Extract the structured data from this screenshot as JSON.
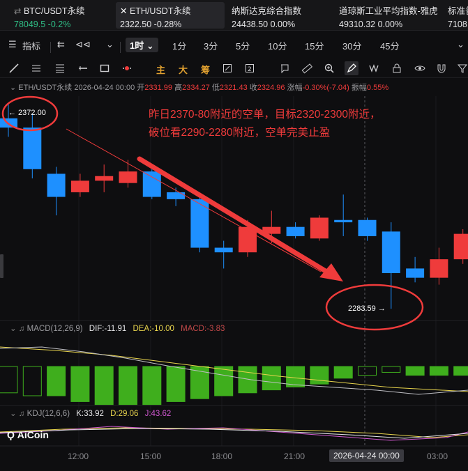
{
  "tickers": [
    {
      "name": "BTC/USDT永续",
      "price": "78049.5",
      "change": "-0.2%"
    },
    {
      "name": "ETH/USDT永续",
      "price": "2322.50",
      "change": "-0.28%"
    },
    {
      "name": "纳斯达克综合指数",
      "price": "24438.50",
      "change": "0.00%"
    },
    {
      "name": "道琼斯工业平均指数-雅虎",
      "price": "49310.32",
      "change": "0.00%"
    },
    {
      "name": "标准普",
      "price": "7108",
      "change": ""
    }
  ],
  "timeframe": {
    "indicator_label": "指标",
    "selected": "1时",
    "options": [
      "1分",
      "3分",
      "5分",
      "10分",
      "15分",
      "30分",
      "45分"
    ]
  },
  "tools": {
    "main_label": "主",
    "big_label": "大",
    "chip_label": "筹"
  },
  "ohlc": {
    "symbol": "ETH/USDT永续",
    "datetime": "2026-04-24 00:00",
    "open_label": "开",
    "open": "2331.99",
    "high_label": "高",
    "high": "2334.27",
    "low_label": "低",
    "low": "2321.43",
    "close_label": "收",
    "close": "2324.96",
    "change_label": "涨幅",
    "change": "-0.30%(-7.04)",
    "amp_label": "振幅",
    "amp": "0.55%"
  },
  "annotation": {
    "line1": "昨日2370-80附近的空单，目标2320-2300附近，",
    "line2": "破位看2290-2280附近，空单完美止盈"
  },
  "high_marker": "← 2372.00",
  "low_marker": "2283.59 →",
  "macd": {
    "label": "MACD(12,26,9)",
    "dif": "DIF:-11.91",
    "dea": "DEA:-10.00",
    "macd": "MACD:-3.83"
  },
  "kdj": {
    "label": "KDJ(12,6,6)",
    "k": "K:33.92",
    "d": "D:29.06",
    "j": "J:43.62"
  },
  "logo": "AiCoin",
  "colors": {
    "up": "#ef3b3b",
    "down": "#1e90ff",
    "annotation": "#ef3b3b",
    "macd_pos": "#3fae1d"
  },
  "chart_data": {
    "type": "candlestick",
    "x_ticks": [
      "12:00",
      "15:00",
      "18:00",
      "21:00",
      "2026-04-24 00:00",
      "03:00"
    ],
    "candles": [
      {
        "o": 2366,
        "h": 2372.0,
        "l": 2358,
        "c": 2362
      },
      {
        "o": 2362,
        "h": 2368,
        "l": 2340,
        "c": 2344
      },
      {
        "o": 2342,
        "h": 2345,
        "l": 2324,
        "c": 2332
      },
      {
        "o": 2334,
        "h": 2342,
        "l": 2332,
        "c": 2339
      },
      {
        "o": 2339,
        "h": 2346,
        "l": 2334,
        "c": 2341
      },
      {
        "o": 2338,
        "h": 2348,
        "l": 2336,
        "c": 2343
      },
      {
        "o": 2343,
        "h": 2344,
        "l": 2331,
        "c": 2332
      },
      {
        "o": 2334,
        "h": 2336,
        "l": 2328,
        "c": 2331
      },
      {
        "o": 2331,
        "h": 2332,
        "l": 2308,
        "c": 2310
      },
      {
        "o": 2310,
        "h": 2313,
        "l": 2301,
        "c": 2308
      },
      {
        "o": 2308,
        "h": 2322,
        "l": 2306,
        "c": 2319
      },
      {
        "o": 2316,
        "h": 2326,
        "l": 2312,
        "c": 2319
      },
      {
        "o": 2319,
        "h": 2321,
        "l": 2314,
        "c": 2315
      },
      {
        "o": 2314,
        "h": 2324,
        "l": 2313,
        "c": 2323
      },
      {
        "o": 2322,
        "h": 2333,
        "l": 2315,
        "c": 2321
      },
      {
        "o": 2322,
        "h": 2323,
        "l": 2313,
        "c": 2315
      },
      {
        "o": 2317,
        "h": 2321,
        "l": 2283.59,
        "c": 2299
      },
      {
        "o": 2301,
        "h": 2306,
        "l": 2295,
        "c": 2297
      },
      {
        "o": 2297,
        "h": 2310,
        "l": 2294,
        "c": 2305
      },
      {
        "o": 2305,
        "h": 2318,
        "l": 2303,
        "c": 2316
      }
    ],
    "macd_hist": [
      -9,
      -10,
      -10,
      -12,
      -13,
      -13,
      -13,
      -12,
      -11,
      -10,
      -9,
      -8,
      -7,
      -6,
      -4,
      -3,
      -2,
      -3,
      -3,
      -3
    ]
  }
}
